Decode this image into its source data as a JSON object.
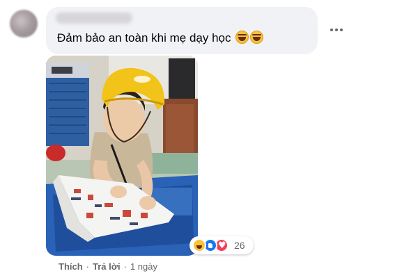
{
  "comment": {
    "text": "Đảm bảo an toàn khi mẹ dạy học",
    "emojis": [
      "rolling-on-floor-laughing",
      "rolling-on-floor-laughing"
    ],
    "image_description": "child wearing yellow helmet writing in a workbook"
  },
  "reactions": {
    "types": [
      "haha",
      "like",
      "love"
    ],
    "count": "26"
  },
  "actions": {
    "like_label": "Thích",
    "reply_label": "Trả lời",
    "separator": "·",
    "timestamp": "1 ngày"
  },
  "colors": {
    "bubble": "#f0f2f5",
    "text": "#050505",
    "secondary_text": "#65676b",
    "like_blue": "#1877f2",
    "love_red": "#f33e58",
    "haha_yellow": "#f7c339"
  }
}
